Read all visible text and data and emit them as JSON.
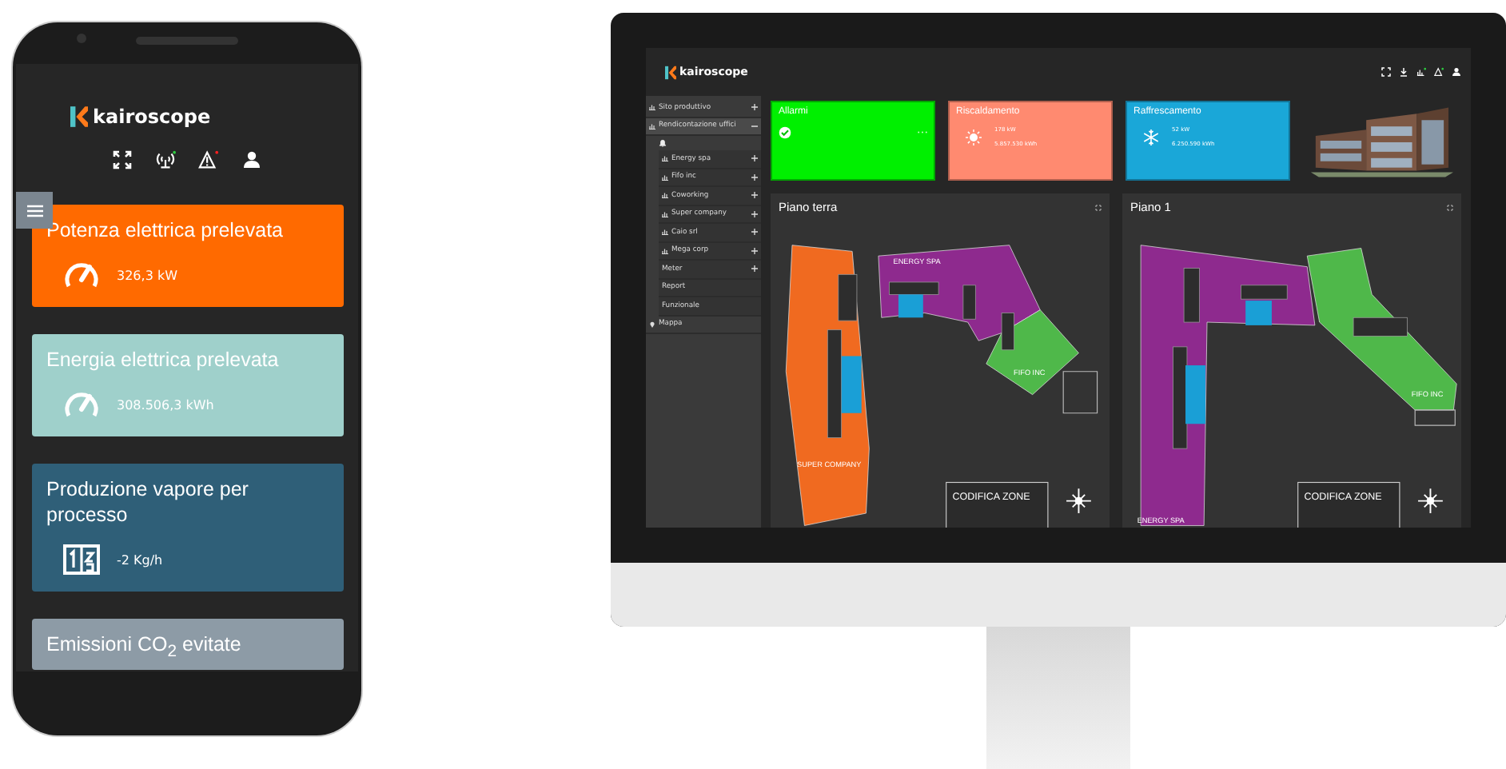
{
  "phone": {
    "brand": "kairoscope",
    "toolbar": [
      {
        "kind": "expand"
      },
      {
        "kind": "signal",
        "color": "#2ecc40"
      },
      {
        "kind": "alert",
        "color": "#ff2020"
      },
      {
        "kind": "user"
      }
    ],
    "cards": [
      {
        "title": "Potenza elettrica prelevata",
        "value": "326,3 kW",
        "kind": "gauge",
        "color": "#ff6a00"
      },
      {
        "title": "Energia elettrica prelevata",
        "value": "308.506,3 kWh",
        "kind": "gauge",
        "color": "#9fd0cb"
      },
      {
        "title": "Produzione vapore per processo",
        "value": "-2 Kg/h",
        "kind": "counter",
        "color": "#2f5f78"
      },
      {
        "title": "Emissioni CO$_{2}$ evitate",
        "color": "#8d9ba6"
      }
    ]
  },
  "monitor": {
    "brand": "kairoscope",
    "toolbar": [
      {
        "kind": "expand"
      },
      {
        "kind": "download"
      },
      {
        "kind": "signal",
        "color": "#2ecc40"
      },
      {
        "kind": "alert",
        "color": "#2ecc40"
      },
      {
        "kind": "user"
      }
    ],
    "sidebar": [
      {
        "label": "Sito produttivo",
        "kind": "chart",
        "expanded": false
      },
      {
        "label": "Rendicontazione uffici",
        "kind": "chart",
        "expanded": true,
        "children": [
          {
            "label": "Energy spa",
            "kind": "chart",
            "expanded": false
          },
          {
            "label": "Fifo inc",
            "kind": "chart",
            "expanded": false
          },
          {
            "label": "Coworking",
            "kind": "chart",
            "expanded": false
          },
          {
            "label": "Super company",
            "kind": "chart",
            "expanded": false
          },
          {
            "label": "Caio srl",
            "kind": "chart",
            "expanded": false
          },
          {
            "label": "Mega corp",
            "kind": "chart",
            "expanded": false
          },
          {
            "label": "Meter",
            "kind": "plain",
            "expanded": false
          },
          {
            "label": "Report",
            "kind": "plain"
          },
          {
            "label": "Funzionale",
            "kind": "plain"
          }
        ]
      },
      {
        "label": "Mappa",
        "kind": "pin"
      }
    ],
    "tiles": [
      {
        "title": "Allarmi",
        "kind": "alarm",
        "color": "#00f000"
      },
      {
        "title": "Riscaldamento",
        "kind": "heat",
        "color": "#ff8a70",
        "power": "178 kW",
        "energy": "5.857.530 kWh"
      },
      {
        "title": "Raffrescamento",
        "kind": "cool",
        "color": "#1aa7d8",
        "power": "52 kW",
        "energy": "6.250.590 kWh"
      }
    ],
    "floors": [
      {
        "title": "Piano terra",
        "labels": [
          "ENERGY SPA",
          "FIFO INC",
          "SUPER COMPANY"
        ],
        "legend": "CODIFICA ZONE"
      },
      {
        "title": "Piano 1",
        "labels": [
          "ENERGY SPA",
          "FIFO INC"
        ],
        "legend": "CODIFICA ZONE"
      }
    ]
  }
}
